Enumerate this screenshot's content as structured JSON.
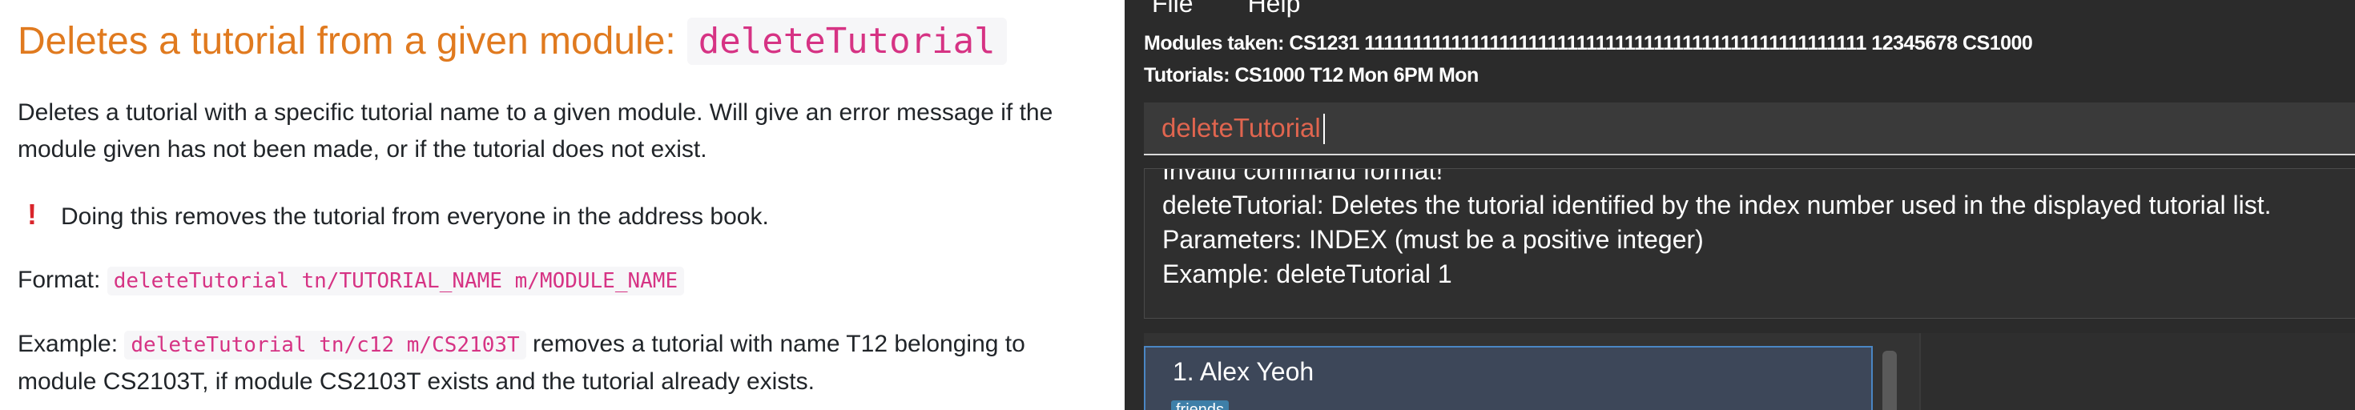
{
  "doc": {
    "heading_text": "Deletes a tutorial from a given module:",
    "heading_code": "deleteTutorial",
    "description_line1": "Deletes a tutorial with a specific tutorial name to a given module. Will give an error message if the",
    "description_line2": "module given has not been made, or if the tutorial does not exist.",
    "warning_icon": "!",
    "warning_text": "Doing this removes the tutorial from everyone in the address book.",
    "format_label": "Format:",
    "format_code": "deleteTutorial tn/TUTORIAL_NAME m/MODULE_NAME",
    "example_label": "Example:",
    "example_code": "deleteTutorial tn/c12 m/CS2103T",
    "example_text_line1": "removes a tutorial with name T12 belonging to",
    "example_text_line2": "module CS2103T, if module CS2103T exists and the tutorial already exists."
  },
  "app": {
    "menu": [
      "File",
      "Help"
    ],
    "modules_taken": "Modules taken: CS1231 1111111111111111111111111111111111111111111111111111 12345678 CS1000",
    "tutorials": "Tutorials: CS1000 T12 Mon 6PM  Mon",
    "command_value": "deleteTutorial",
    "result_lines": [
      "Invalid command format!",
      "deleteTutorial: Deletes the tutorial identified by the index number used in the displayed tutorial list.",
      "Parameters: INDEX (must be a positive integer)",
      "Example: deleteTutorial 1"
    ],
    "person": {
      "index_name": "1.  Alex Yeoh",
      "tag": "friends"
    }
  }
}
